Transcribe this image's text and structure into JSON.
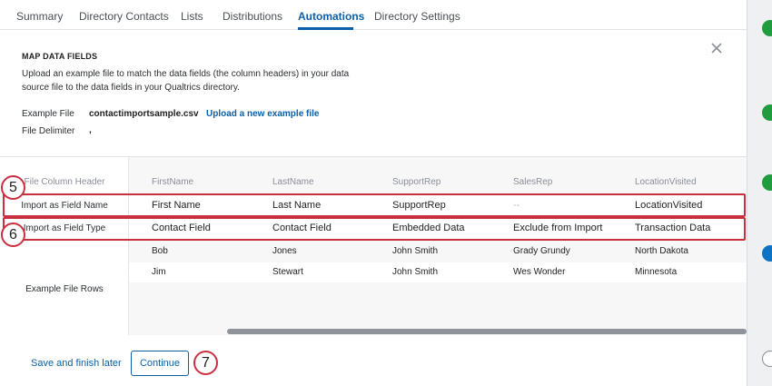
{
  "tabs": [
    {
      "label": "Summary",
      "active": false
    },
    {
      "label": "Directory Contacts",
      "active": false
    },
    {
      "label": "Lists",
      "active": false
    },
    {
      "label": "Distributions",
      "active": false
    },
    {
      "label": "Automations",
      "active": true
    },
    {
      "label": "Directory Settings",
      "active": false
    }
  ],
  "modal": {
    "title": "MAP DATA FIELDS",
    "close_icon": "close-icon",
    "description": "Upload an example file to match the data fields (the column headers) in your data source file to the data fields in your Qualtrics directory.",
    "example_file_label": "Example File",
    "example_file_value": "contactimportsample.csv",
    "upload_link": "Upload a new example file",
    "file_delimiter_label": "File Delimiter",
    "file_delimiter_value": ","
  },
  "table": {
    "row_labels": {
      "header": "File Column Header",
      "field_name": "Import as Field Name",
      "field_type": "Import as Field Type",
      "example_rows": "Example File Rows"
    },
    "columns": [
      {
        "header": "FirstName",
        "field_name": "First Name",
        "field_type": "Contact Field"
      },
      {
        "header": "LastName",
        "field_name": "Last Name",
        "field_type": "Contact Field"
      },
      {
        "header": "SupportRep",
        "field_name": "SupportRep",
        "field_type": "Embedded Data"
      },
      {
        "header": "SalesRep",
        "field_name": "--",
        "field_type": "Exclude from Import"
      },
      {
        "header": "LocationVisited",
        "field_name": "LocationVisited",
        "field_type": "Transaction Data"
      }
    ],
    "example_rows": [
      [
        "Bob",
        "Jones",
        "John Smith",
        "Grady Grundy",
        "North Dakota"
      ],
      [
        "Jim",
        "Stewart",
        "John Smith",
        "Wes Wonder",
        "Minnesota"
      ]
    ]
  },
  "callouts": {
    "five": "5",
    "six": "6",
    "seven": "7"
  },
  "footer": {
    "save_later": "Save and finish later",
    "continue": "Continue"
  },
  "side_icons": [
    {
      "name": "check-circle-icon",
      "color": "#1f9c3d"
    },
    {
      "name": "check-circle-icon",
      "color": "#1f9c3d"
    },
    {
      "name": "check-circle-icon",
      "color": "#1f9c3d"
    },
    {
      "name": "check-circle-icon",
      "color": "#1f9c3d"
    },
    {
      "name": "info-circle-icon",
      "color": "#0b72c4"
    },
    {
      "name": "empty-circle-icon",
      "color": "#8a8f96"
    }
  ],
  "colors": {
    "accent": "#0b5fa8",
    "highlight": "#c8303f"
  }
}
